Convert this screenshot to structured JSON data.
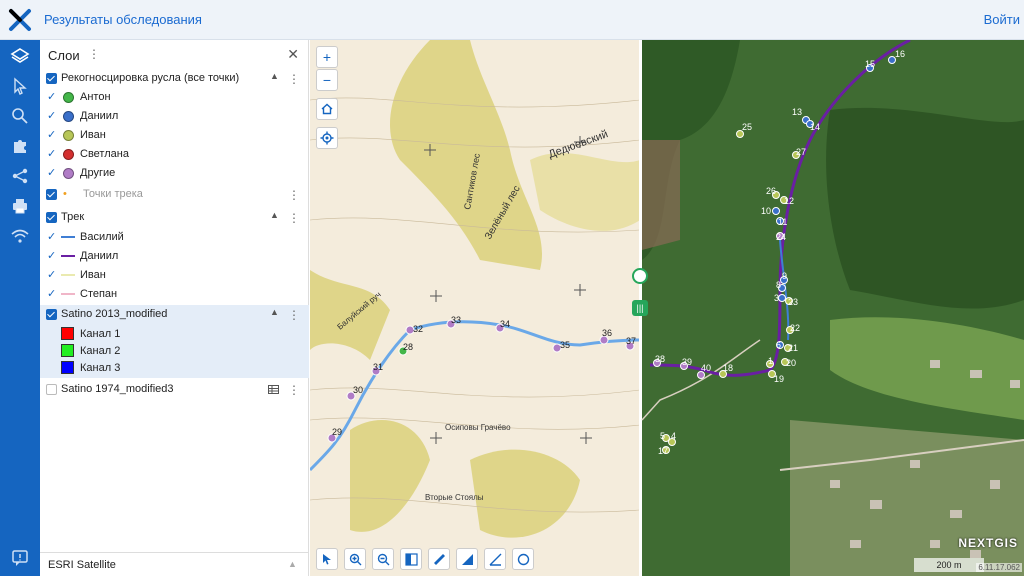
{
  "header": {
    "title": "Результаты обследования",
    "login": "Войти"
  },
  "layers_panel": {
    "title": "Слои",
    "groups": [
      {
        "label": "Рекогносцировка русла (все точки)",
        "items": [
          {
            "label": "Антон",
            "color": "#43b649"
          },
          {
            "label": "Даниил",
            "color": "#3a6fc9"
          },
          {
            "label": "Иван",
            "color": "#b7c657"
          },
          {
            "label": "Светлана",
            "color": "#d32f2f"
          },
          {
            "label": "Другие",
            "color": "#b07cc6"
          }
        ]
      },
      {
        "label": "Точки трека"
      },
      {
        "label": "Трек",
        "items": [
          {
            "label": "Василий",
            "color": "#3f7ed4"
          },
          {
            "label": "Даниил",
            "color": "#6a1fa3"
          },
          {
            "label": "Иван",
            "color": "#eaeab0"
          },
          {
            "label": "Степан",
            "color": "#f0b6c8"
          }
        ]
      },
      {
        "label": "Satino 2013_modified",
        "items": [
          {
            "label": "Канал 1",
            "color": "#ff0000"
          },
          {
            "label": "Канал 2",
            "color": "#22ee22"
          },
          {
            "label": "Канал 3",
            "color": "#0000ff"
          }
        ]
      },
      {
        "label": "Satino 1974_modified3"
      }
    ],
    "basemap": "ESRI Satellite"
  },
  "map": {
    "topo_labels": [
      "Дедюевский",
      "Зелёный лес",
      "Сантиков лес",
      "Балуйский руч",
      "Осиповы Грачёво",
      "Вторые Стоялы"
    ],
    "topo_points": [
      "29",
      "30",
      "31",
      "28",
      "32",
      "33",
      "34",
      "35",
      "36",
      "37"
    ],
    "sat_points": [
      "16",
      "15",
      "13",
      "14",
      "25",
      "27",
      "26",
      "12",
      "10",
      "11",
      "24",
      "9",
      "8",
      "3",
      "23",
      "22",
      "6",
      "21",
      "20",
      "1",
      "19",
      "38",
      "39",
      "40",
      "18",
      "5",
      "4",
      "17"
    ],
    "watermark": "NEXTGIS",
    "scale": "200 m",
    "version": "6.11.17.062"
  }
}
